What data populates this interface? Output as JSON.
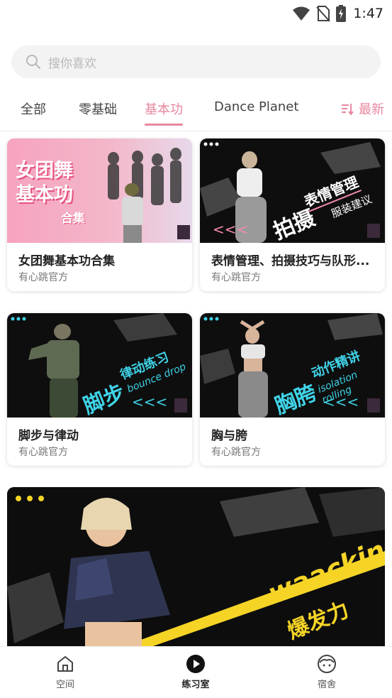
{
  "status_bar": {
    "time": "1:47",
    "icons": [
      "wifi-icon",
      "no-sim-icon",
      "battery-charging-icon"
    ]
  },
  "search": {
    "placeholder": "搜你喜欢",
    "icon": "search-icon"
  },
  "tabs": [
    {
      "label": "全部",
      "active": false
    },
    {
      "label": "零基础",
      "active": false
    },
    {
      "label": "基本功",
      "active": true
    },
    {
      "label": "Dance Planet",
      "active": false
    }
  ],
  "sort": {
    "label": "最新",
    "icon": "sort-icon"
  },
  "cards": [
    {
      "title": "女团舞基本功合集",
      "author": "有心跳官方",
      "thumb_text_1": "女团舞",
      "thumb_text_2": "基本功",
      "thumb_text_3": "合集"
    },
    {
      "title": "表情管理、拍摄技巧与队形...",
      "author": "有心跳官方",
      "thumb_text_1": "拍摄",
      "thumb_text_2": "表情管理",
      "thumb_text_3": "服装建议"
    },
    {
      "title": "脚步与律动",
      "author": "有心跳官方",
      "thumb_text_1": "脚步",
      "thumb_text_2": "律动练习",
      "thumb_text_3": "bounce drop"
    },
    {
      "title": "胸与胯",
      "author": "有心跳官方",
      "thumb_text_1": "胸胯",
      "thumb_text_2": "动作精讲",
      "thumb_text_3": "isolation rolling"
    }
  ],
  "feature": {
    "thumb_text_1": "waacking",
    "thumb_text_2": "爆发力"
  },
  "bottom_nav": [
    {
      "label": "空间",
      "icon": "home-icon",
      "active": false
    },
    {
      "label": "练习室",
      "icon": "play-circle-icon",
      "active": true
    },
    {
      "label": "宿舍",
      "icon": "face-icon",
      "active": false
    }
  ],
  "colors": {
    "accent": "#e8879e",
    "thumb_pink": "#f08bb0",
    "thumb_cyan": "#3fd3e8",
    "thumb_yellow": "#f5d426"
  }
}
